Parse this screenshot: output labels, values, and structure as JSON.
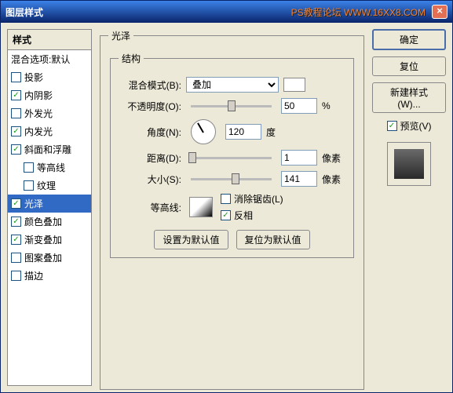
{
  "title": "图层样式",
  "watermark": "PS教程论坛 WWW.16XX8.COM",
  "styles_header": "样式",
  "blend_options": "混合选项:默认",
  "items": {
    "drop_shadow": "投影",
    "inner_shadow": "内阴影",
    "outer_glow": "外发光",
    "inner_glow": "内发光",
    "bevel": "斜面和浮雕",
    "contour_item": "等高线",
    "texture": "纹理",
    "satin": "光泽",
    "color_overlay": "颜色叠加",
    "gradient_overlay": "渐变叠加",
    "pattern_overlay": "图案叠加",
    "stroke": "描边"
  },
  "panel": {
    "group_title": "光泽",
    "structure": "结构",
    "blend_mode_label": "混合模式(B):",
    "blend_mode_value": "叠加",
    "opacity_label": "不透明度(O):",
    "opacity_value": "50",
    "opacity_unit": "%",
    "angle_label": "角度(N):",
    "angle_value": "120",
    "angle_unit": "度",
    "distance_label": "距离(D):",
    "distance_value": "1",
    "distance_unit": "像素",
    "size_label": "大小(S):",
    "size_value": "141",
    "size_unit": "像素",
    "contour_label": "等高线:",
    "antialias": "消除锯齿(L)",
    "invert": "反相",
    "set_default": "设置为默认值",
    "reset_default": "复位为默认值"
  },
  "buttons": {
    "ok": "确定",
    "cancel": "复位",
    "new_style": "新建样式(W)...",
    "preview": "预览(V)"
  }
}
